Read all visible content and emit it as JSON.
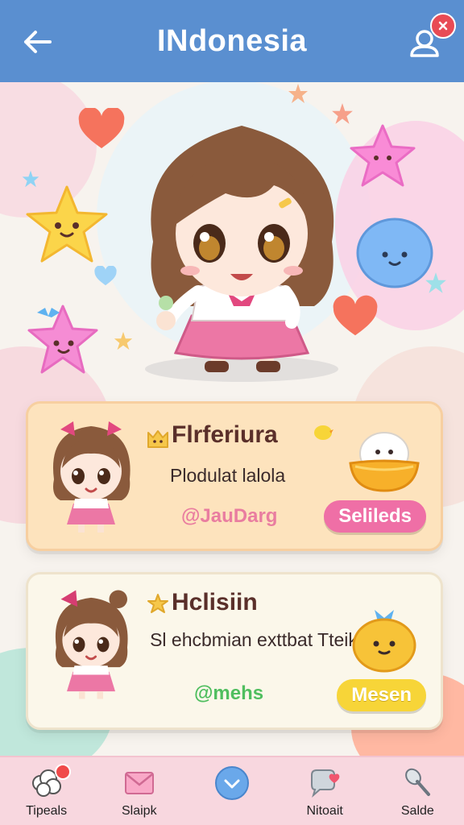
{
  "header": {
    "title": "INdonesia"
  },
  "cards": [
    {
      "title": "Flrferiura",
      "subtitle": "Plodulat lalola",
      "handle": "@JauDarg",
      "button": "Selileds",
      "accent": "#ef6fa6"
    },
    {
      "title": "Hclisiin",
      "subtitle": "Sl ehcbmian exttbat Tteik",
      "handle": "@mehs",
      "button": "Mesen",
      "accent": "#f7d538"
    }
  ],
  "nav": {
    "items": [
      {
        "label": "Tipeals",
        "icon": "sheep-icon"
      },
      {
        "label": "Slaipk",
        "icon": "envelope-icon"
      },
      {
        "label": "",
        "icon": "chevron-down-icon"
      },
      {
        "label": "Nitoait",
        "icon": "chat-heart-icon"
      },
      {
        "label": "Salde",
        "icon": "spoon-icon"
      }
    ]
  },
  "colors": {
    "header": "#5a8fd0",
    "nav": "#f8d7df",
    "card1": "#fde3bd",
    "card2": "#fbf7ea"
  }
}
